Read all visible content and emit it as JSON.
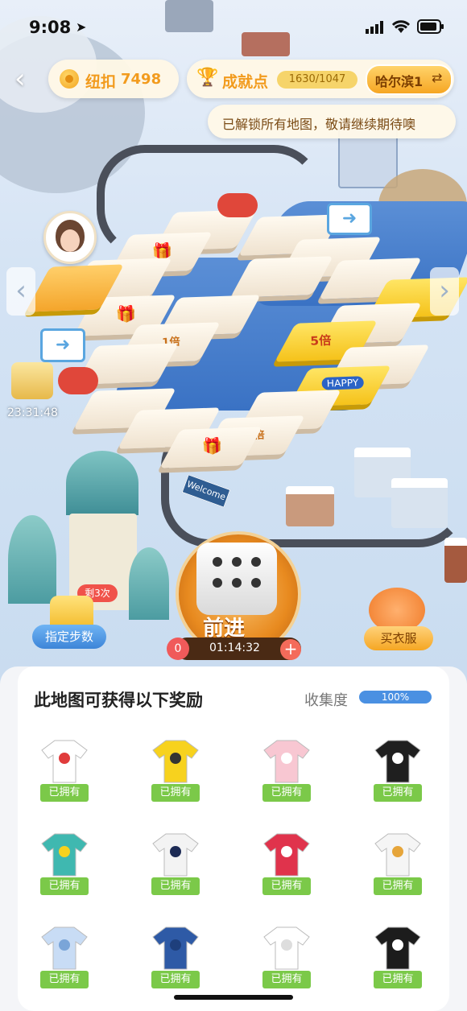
{
  "status_bar": {
    "time": "9:08",
    "icons": [
      "location-arrow-icon",
      "signal-icon",
      "wifi-icon",
      "battery-icon"
    ]
  },
  "header": {
    "back_icon": "chevron-left-icon",
    "buttons_label": "纽扣",
    "buttons_value": "7498",
    "achievement_label": "成就点",
    "achievement_value": "1630/1047",
    "city_label": "哈尔滨1",
    "swap_icon": "swap-icon"
  },
  "notice": {
    "text": "已解锁所有地图，敬请继续期待噢"
  },
  "map": {
    "timer": "23:31:48",
    "welcome_sign": "Welcome",
    "tile_labels": [
      "1倍",
      "5倍",
      "1倍"
    ],
    "happy_mark": "HAPPY"
  },
  "controls": {
    "step_badge": "剩3次",
    "step_button": "指定步数",
    "roll_button": "前进",
    "count_left": "0",
    "countdown": "01:14:32",
    "plus": "+",
    "shop_button": "买衣服"
  },
  "rewards": {
    "title": "此地图可获得以下奖励",
    "progress_label": "收集度",
    "progress_value": "100%",
    "progress_fraction": 1.0,
    "owned_label": "已拥有",
    "items": [
      {
        "name": "white-heart-jacket",
        "color": "#ffffff",
        "accent": "#e03c3c"
      },
      {
        "name": "yellow-happy-tee",
        "color": "#f7d21e",
        "accent": "#333333"
      },
      {
        "name": "pink-tee",
        "color": "#f8c7d2",
        "accent": "#ffffff"
      },
      {
        "name": "black-panda-tee",
        "color": "#1f1f1f",
        "accent": "#ffffff"
      },
      {
        "name": "teal-duck-tee",
        "color": "#3fb8b0",
        "accent": "#f7d21e"
      },
      {
        "name": "navy-raglan-tee",
        "color": "#f3f3f3",
        "accent": "#1d2b55"
      },
      {
        "name": "red-puffer-jacket",
        "color": "#e0334c",
        "accent": "#ffffff"
      },
      {
        "name": "white-sport-jacket",
        "color": "#f5f5f5",
        "accent": "#e6a53a"
      },
      {
        "name": "blue-stripe-shirt",
        "color": "#c8dcf5",
        "accent": "#7aa5d8"
      },
      {
        "name": "denim-skirt",
        "color": "#2e5aa6",
        "accent": "#1e3f7c"
      },
      {
        "name": "white-tiered-skirt",
        "color": "#ffffff",
        "accent": "#dddddd"
      },
      {
        "name": "black-white-coat",
        "color": "#1c1c1c",
        "accent": "#ffffff"
      }
    ]
  },
  "colors": {
    "accent_orange": "#f29b1d",
    "progress_blue": "#4a90e2",
    "owned_green": "#7bc949"
  }
}
